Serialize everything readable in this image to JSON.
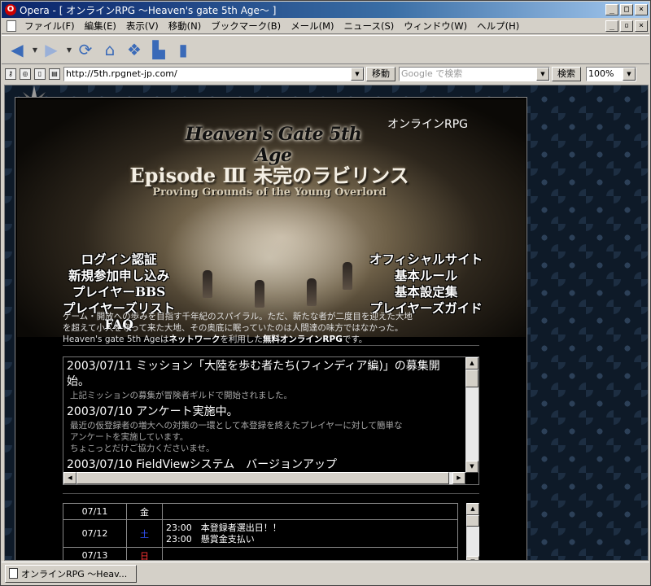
{
  "window": {
    "title": "Opera - [ オンラインRPG 〜Heaven's gate 5th Age〜 ]",
    "app_icon": "opera-icon",
    "controls": [
      "_",
      "□",
      "×"
    ]
  },
  "menubar": {
    "items": [
      "ファイル(F)",
      "編集(E)",
      "表示(V)",
      "移動(N)",
      "ブックマーク(B)",
      "メール(M)",
      "ニュース(S)",
      "ウィンドウ(W)",
      "ヘルプ(H)"
    ],
    "doc_controls": [
      "_",
      "▫",
      "×"
    ]
  },
  "navbar": {
    "icons": [
      "back-arrow-icon",
      "forward-arrow-icon",
      "reload-icon",
      "home-icon",
      "hotlist-icon",
      "print-icon",
      "page-icon"
    ]
  },
  "addressbar": {
    "url": "http://5th.rpgnet-jp.com/",
    "go_label": "移動",
    "search_placeholder": "Google で検索",
    "search_label": "検索",
    "zoom": "100%"
  },
  "page": {
    "corner_label": "オンラインRPG",
    "logo_text": "Heaven's Gate 5th Age",
    "episode_title": "Episode Ⅲ 未完のラビリンス",
    "episode_subtitle": "Proving Grounds of the Young Overlord",
    "nav_left": [
      "ログイン認証",
      "新規参加申し込み",
      "プレイヤーBBS",
      "プレイヤーズリスト",
      "FAQ"
    ],
    "nav_right": [
      "オフィシャルサイト",
      "基本ルール",
      "基本設定集",
      "プレイヤーズガイド"
    ],
    "intro_line1": "ゲーム・開放への歩みを目指す千年紀のスパイラル。ただ、新たな者が二度目を迎えた大地",
    "intro_line2": "を超えて小人を守って来た大地、その奥底に眠っていたのは人間達の味方ではなかった。",
    "intro_line3_a": "Heaven's gate 5th Ageは",
    "intro_line3_b": "ネットワーク",
    "intro_line3_c": "を利用した",
    "intro_line3_d": "無料オンラインRPG",
    "intro_line3_e": "です。",
    "news": [
      {
        "title": "2003/07/11 ミッション「大陸を歩む者たち(フィンディア編)」の募集開始。",
        "body": [
          "上記ミッションの募集が冒険者ギルドで開始されました。"
        ]
      },
      {
        "title": "2003/07/10 アンケート実施中。",
        "body": [
          "最近の仮登録者の増大への対策の一環として本登録を終えたプレイヤーに対して簡単な",
          "アンケートを実施しています。",
          "ちょこっとだけご協力くださいませ。"
        ]
      },
      {
        "title": "2003/07/10 FieldViewシステム　バージョンアップ",
        "body": []
      }
    ],
    "calendar": [
      {
        "date": "07/11",
        "weekday": "金",
        "events": []
      },
      {
        "date": "07/12",
        "weekday": "土",
        "events": [
          "23:00　本登録者選出日！！",
          "23:00　懸賞金支払い"
        ]
      },
      {
        "date": "07/13",
        "weekday": "日",
        "events": []
      }
    ],
    "weekday_colors": {
      "sat": "#3355ff",
      "sun": "#ff3333"
    }
  },
  "statusbar": {
    "tab_label": "オンラインRPG 〜Heav..."
  }
}
